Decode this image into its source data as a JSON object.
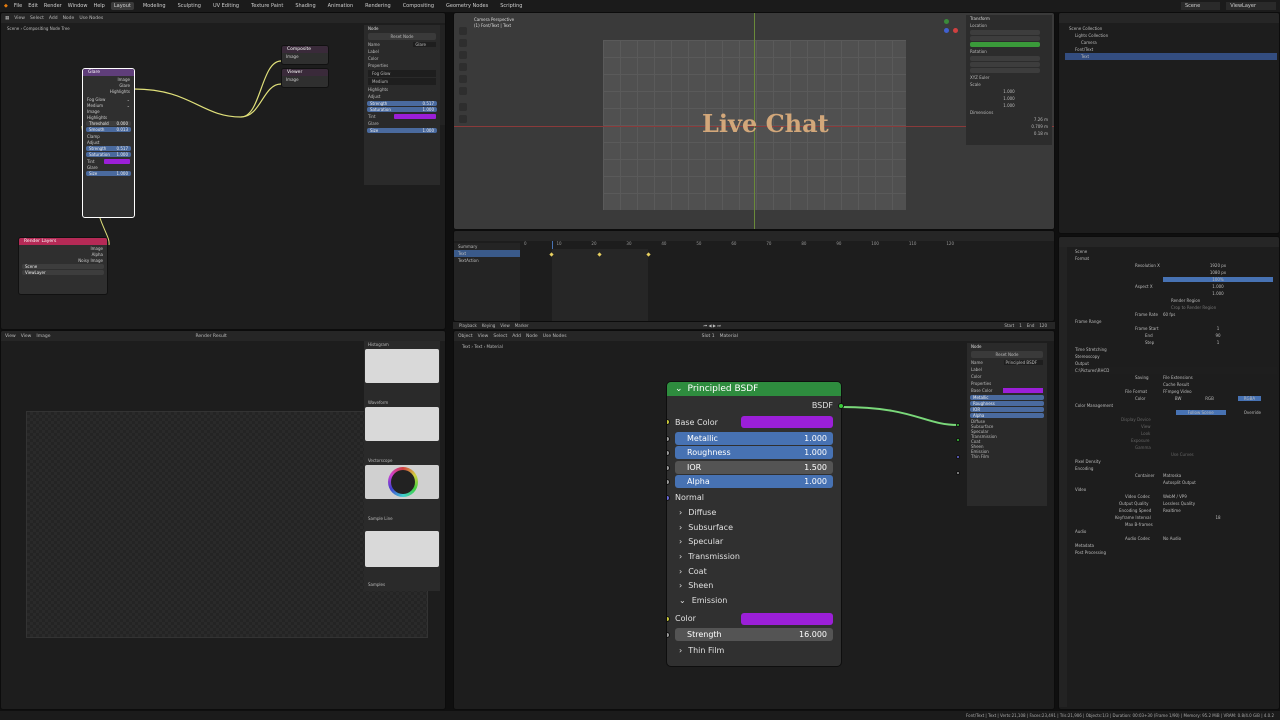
{
  "topbar": {
    "menus": [
      "File",
      "Edit",
      "Render",
      "Window",
      "Help"
    ],
    "workspaces": [
      "Layout",
      "Modeling",
      "Sculpting",
      "UV Editing",
      "Texture Paint",
      "Shading",
      "Animation",
      "Rendering",
      "Compositing",
      "Geometry Nodes",
      "Scripting"
    ],
    "active_workspace": "Layout",
    "scene": "Scene",
    "view_layer": "ViewLayer"
  },
  "compositor": {
    "header": [
      "View",
      "Select",
      "Add",
      "Node",
      "Use Nodes"
    ],
    "breadcrumb": [
      "Scene",
      "Compositing Node Tree"
    ],
    "glare_node": {
      "title": "Glare",
      "outputs": [
        "Image",
        "Glare",
        "Highlights"
      ],
      "type": "Fog Glow",
      "quality": "Medium",
      "rows": [
        "Image",
        "Highlights"
      ],
      "threshold": "Threshold",
      "threshold_val": "0.000",
      "smooth": "Smooth",
      "smooth_val": "0.013",
      "clamp": "Clamp",
      "adjust": "Adjust",
      "strength": "Strength",
      "strength_val": "0.517",
      "saturation": "Saturation",
      "saturation_val": "1.000",
      "tint": "Tint",
      "glare_section": "Glare",
      "size": "Size",
      "size_val": "1.000"
    },
    "composite_node": {
      "title": "Composite",
      "input": "Image"
    },
    "viewer_node": {
      "title": "Viewer",
      "input": "Image"
    },
    "render_layers_node": {
      "title": "Render Layers",
      "outputs": [
        "Image",
        "Alpha",
        "Noisy Image"
      ],
      "scene": "Scene",
      "view_layer": "ViewLayer"
    },
    "sidebar": {
      "tabs": [
        "Node",
        "Tool",
        "View",
        "Options"
      ],
      "node_label": "Node",
      "reset": "Reset Node",
      "name": "Name",
      "name_val": "Glare",
      "label": "Label",
      "color": "Color",
      "properties": "Properties",
      "type": "Fog Glow",
      "quality": "Medium",
      "highlights": "Highlights",
      "adjust": "Adjust",
      "strength": "Strength",
      "strength_val": "0.517",
      "saturation": "Saturation",
      "saturation_val": "1.000",
      "tint": "Tint",
      "glare": "Glare",
      "size": "Size",
      "size_val": "1.000"
    }
  },
  "viewport": {
    "mode": "Camera Perspective",
    "object": "(1) Font/Text | Text",
    "text": "Live Chat",
    "n_panel": {
      "title": "Transform",
      "location": "Location",
      "rotation": "Rotation",
      "mode": "XYZ Euler",
      "scale": "Scale",
      "scale_vals": [
        "1.000",
        "1.000",
        "1.000"
      ],
      "dimensions": "Dimensions",
      "dim_vals": [
        "7.26 m",
        "0.709 m",
        "0.18 m"
      ]
    }
  },
  "timeline": {
    "header": [
      "Playback",
      "Keying",
      "View",
      "Marker"
    ],
    "ticks": [
      "0",
      "10",
      "20",
      "30",
      "40",
      "50",
      "60",
      "70",
      "80",
      "90",
      "100",
      "110",
      "120"
    ],
    "outliner": [
      "Summary",
      "Text",
      "TextAction"
    ],
    "start": "Start",
    "start_val": "1",
    "end": "End",
    "end_val": "120"
  },
  "image_editor": {
    "header": [
      "View",
      "View",
      "Image"
    ],
    "render_result": "Render Result",
    "scopes": [
      "Histogram",
      "Waveform",
      "Vectorscope",
      "Sample Line",
      "Samples"
    ]
  },
  "shader": {
    "header": [
      "Object",
      "View",
      "Select",
      "Add",
      "Node",
      "Use Nodes"
    ],
    "slot": "Slot 1",
    "material": "Material",
    "breadcrumb": [
      "Text",
      "Text",
      "Material"
    ],
    "bsdf": {
      "title": "Principled BSDF",
      "output": "BSDF",
      "base_color": "Base Color",
      "metallic": "Metallic",
      "metallic_val": "1.000",
      "roughness": "Roughness",
      "roughness_val": "1.000",
      "ior": "IOR",
      "ior_val": "1.500",
      "alpha": "Alpha",
      "alpha_val": "1.000",
      "normal": "Normal",
      "subpanels": [
        "Diffuse",
        "Subsurface",
        "Specular",
        "Transmission",
        "Coat",
        "Sheen"
      ],
      "emission": "Emission",
      "color": "Color",
      "strength": "Strength",
      "strength_val": "16.000",
      "thin_film": "Thin Film"
    },
    "sidebar": {
      "node": "Node",
      "reset": "Reset Node",
      "name": "Name",
      "name_val": "Principled BSDF",
      "label": "Label",
      "color": "Color",
      "properties": "Properties",
      "items": [
        "Base Color",
        "Metallic",
        "Roughness",
        "IOR",
        "Alpha",
        "Diffuse",
        "Subsurface",
        "Specular",
        "Transmission",
        "Coat",
        "Sheen",
        "Emission",
        "Thin Film"
      ]
    }
  },
  "outliner": {
    "items": [
      "Scene Collection",
      "Lights Collection",
      "Camera",
      "Font/Text",
      "Text"
    ]
  },
  "properties": {
    "scene": "Scene",
    "format": "Format",
    "resolution_x": "Resolution X",
    "res_x_val": "1920 px",
    "res_y_val": "1080 px",
    "res_pct_val": "100%",
    "aspect_x": "Aspect X",
    "aspect_x_val": "1.000",
    "aspect_y_val": "1.000",
    "render_region": "Render Region",
    "crop": "Crop to Render Region",
    "frame_rate": "Frame Rate",
    "frame_rate_val": "60 fps",
    "frame_range": "Frame Range",
    "frame_start": "Frame Start",
    "frame_start_val": "1",
    "end": "End",
    "end_val": "90",
    "step": "Step",
    "step_val": "1",
    "time_stretching": "Time Stretching",
    "stereoscopy": "Stereoscopy",
    "output": "Output",
    "output_path": "C:\\Pictures\\RHCD",
    "saving": "Saving",
    "file_ext": "File Extensions",
    "cache_result": "Cache Result",
    "file_format": "File Format",
    "file_format_val": "FFmpeg Video",
    "color": "Color",
    "bw": "BW",
    "rgb": "RGB",
    "rgba": "RGBA",
    "color_management": "Color Management",
    "follow_scene": "Follow Scene",
    "override": "Override",
    "metadata_items": [
      "Display Device",
      "View",
      "Look",
      "Exposure",
      "Gamma"
    ],
    "use_curves": "Use Curves",
    "pixel_density": "Pixel Density",
    "encoding": "Encoding",
    "container": "Container",
    "container_val": "Matroska",
    "autosplit": "Autosplit Output",
    "video": "Video",
    "video_codec": "Video Codec",
    "video_codec_val": "WebM / VP9",
    "output_quality": "Output Quality",
    "output_quality_val": "Lossless Quality",
    "encoding_speed": "Encoding Speed",
    "encoding_speed_val": "Realtime",
    "keyframe_interval": "Keyframe Interval",
    "keyframe_val": "18",
    "max_bframes": "Max B-frames",
    "audio": "Audio",
    "audio_codec": "Audio Codec",
    "audio_codec_val": "No Audio",
    "metadata": "Metadata",
    "post_processing": "Post Processing"
  },
  "status_bar": "Font/Text | Text | Verts:21,108 | Faces:23,491 | Tris:21,906 | Objects:1/3 | Duration: 00:03+30 (Frame 1/90) | Memory: 95.2 MiB | VRAM: 0.8/4.0 GiB | 4.0.2",
  "colors": {
    "glare_header": "#5f3e7a",
    "composite_header": "#3a2a3a",
    "render_layers_header": "#b52a56",
    "bsdf_header": "#2e8c3e",
    "field_blue": "#4772b3",
    "purple_swatch": "#9b1fd8",
    "socket_yellow": "#c8c83a",
    "socket_gray": "#9a9a9a",
    "socket_purple": "#6868d8",
    "socket_green": "#3ac83a",
    "text_color": "#d2a77a"
  }
}
